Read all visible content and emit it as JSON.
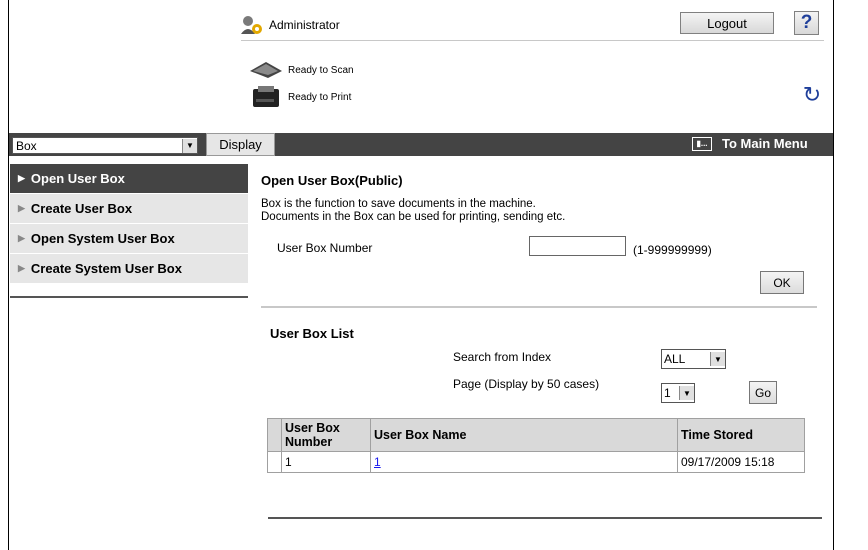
{
  "header": {
    "user_label": "Administrator",
    "logout_label": "Logout",
    "help_label": "?",
    "status": [
      {
        "icon": "scanner-icon",
        "text": "Ready to Scan"
      },
      {
        "icon": "printer-icon",
        "text": "Ready to Print"
      }
    ]
  },
  "toolbar": {
    "mode_select_value": "Box",
    "display_label": "Display",
    "main_menu_label": "To Main Menu"
  },
  "sidebar": {
    "items": [
      {
        "label": "Open User Box",
        "active": true
      },
      {
        "label": "Create User Box",
        "active": false
      },
      {
        "label": "Open System User Box",
        "active": false
      },
      {
        "label": "Create System User Box",
        "active": false
      }
    ]
  },
  "open_box": {
    "title": "Open User Box(Public)",
    "desc_line1": "Box is the function to save documents in the machine.",
    "desc_line2": "Documents in the Box can be used for printing, sending etc.",
    "number_label": "User Box Number",
    "range_hint": "(1-999999999)",
    "ok_label": "OK"
  },
  "box_list": {
    "title": "User Box List",
    "search_label": "Search from Index",
    "search_value": "ALL",
    "page_label": "Page (Display by 50 cases)",
    "page_value": "1",
    "go_label": "Go",
    "columns": [
      "User Box Number",
      "User Box Name",
      "Time Stored"
    ],
    "rows": [
      {
        "number": "1",
        "name": "1",
        "time": "09/17/2009 15:18"
      }
    ]
  },
  "colors": {
    "bar_dark": "#444444",
    "sidebar_bg": "#e6e6e6",
    "link": "#1a1aee",
    "icon_blue": "#1f3f9a"
  }
}
